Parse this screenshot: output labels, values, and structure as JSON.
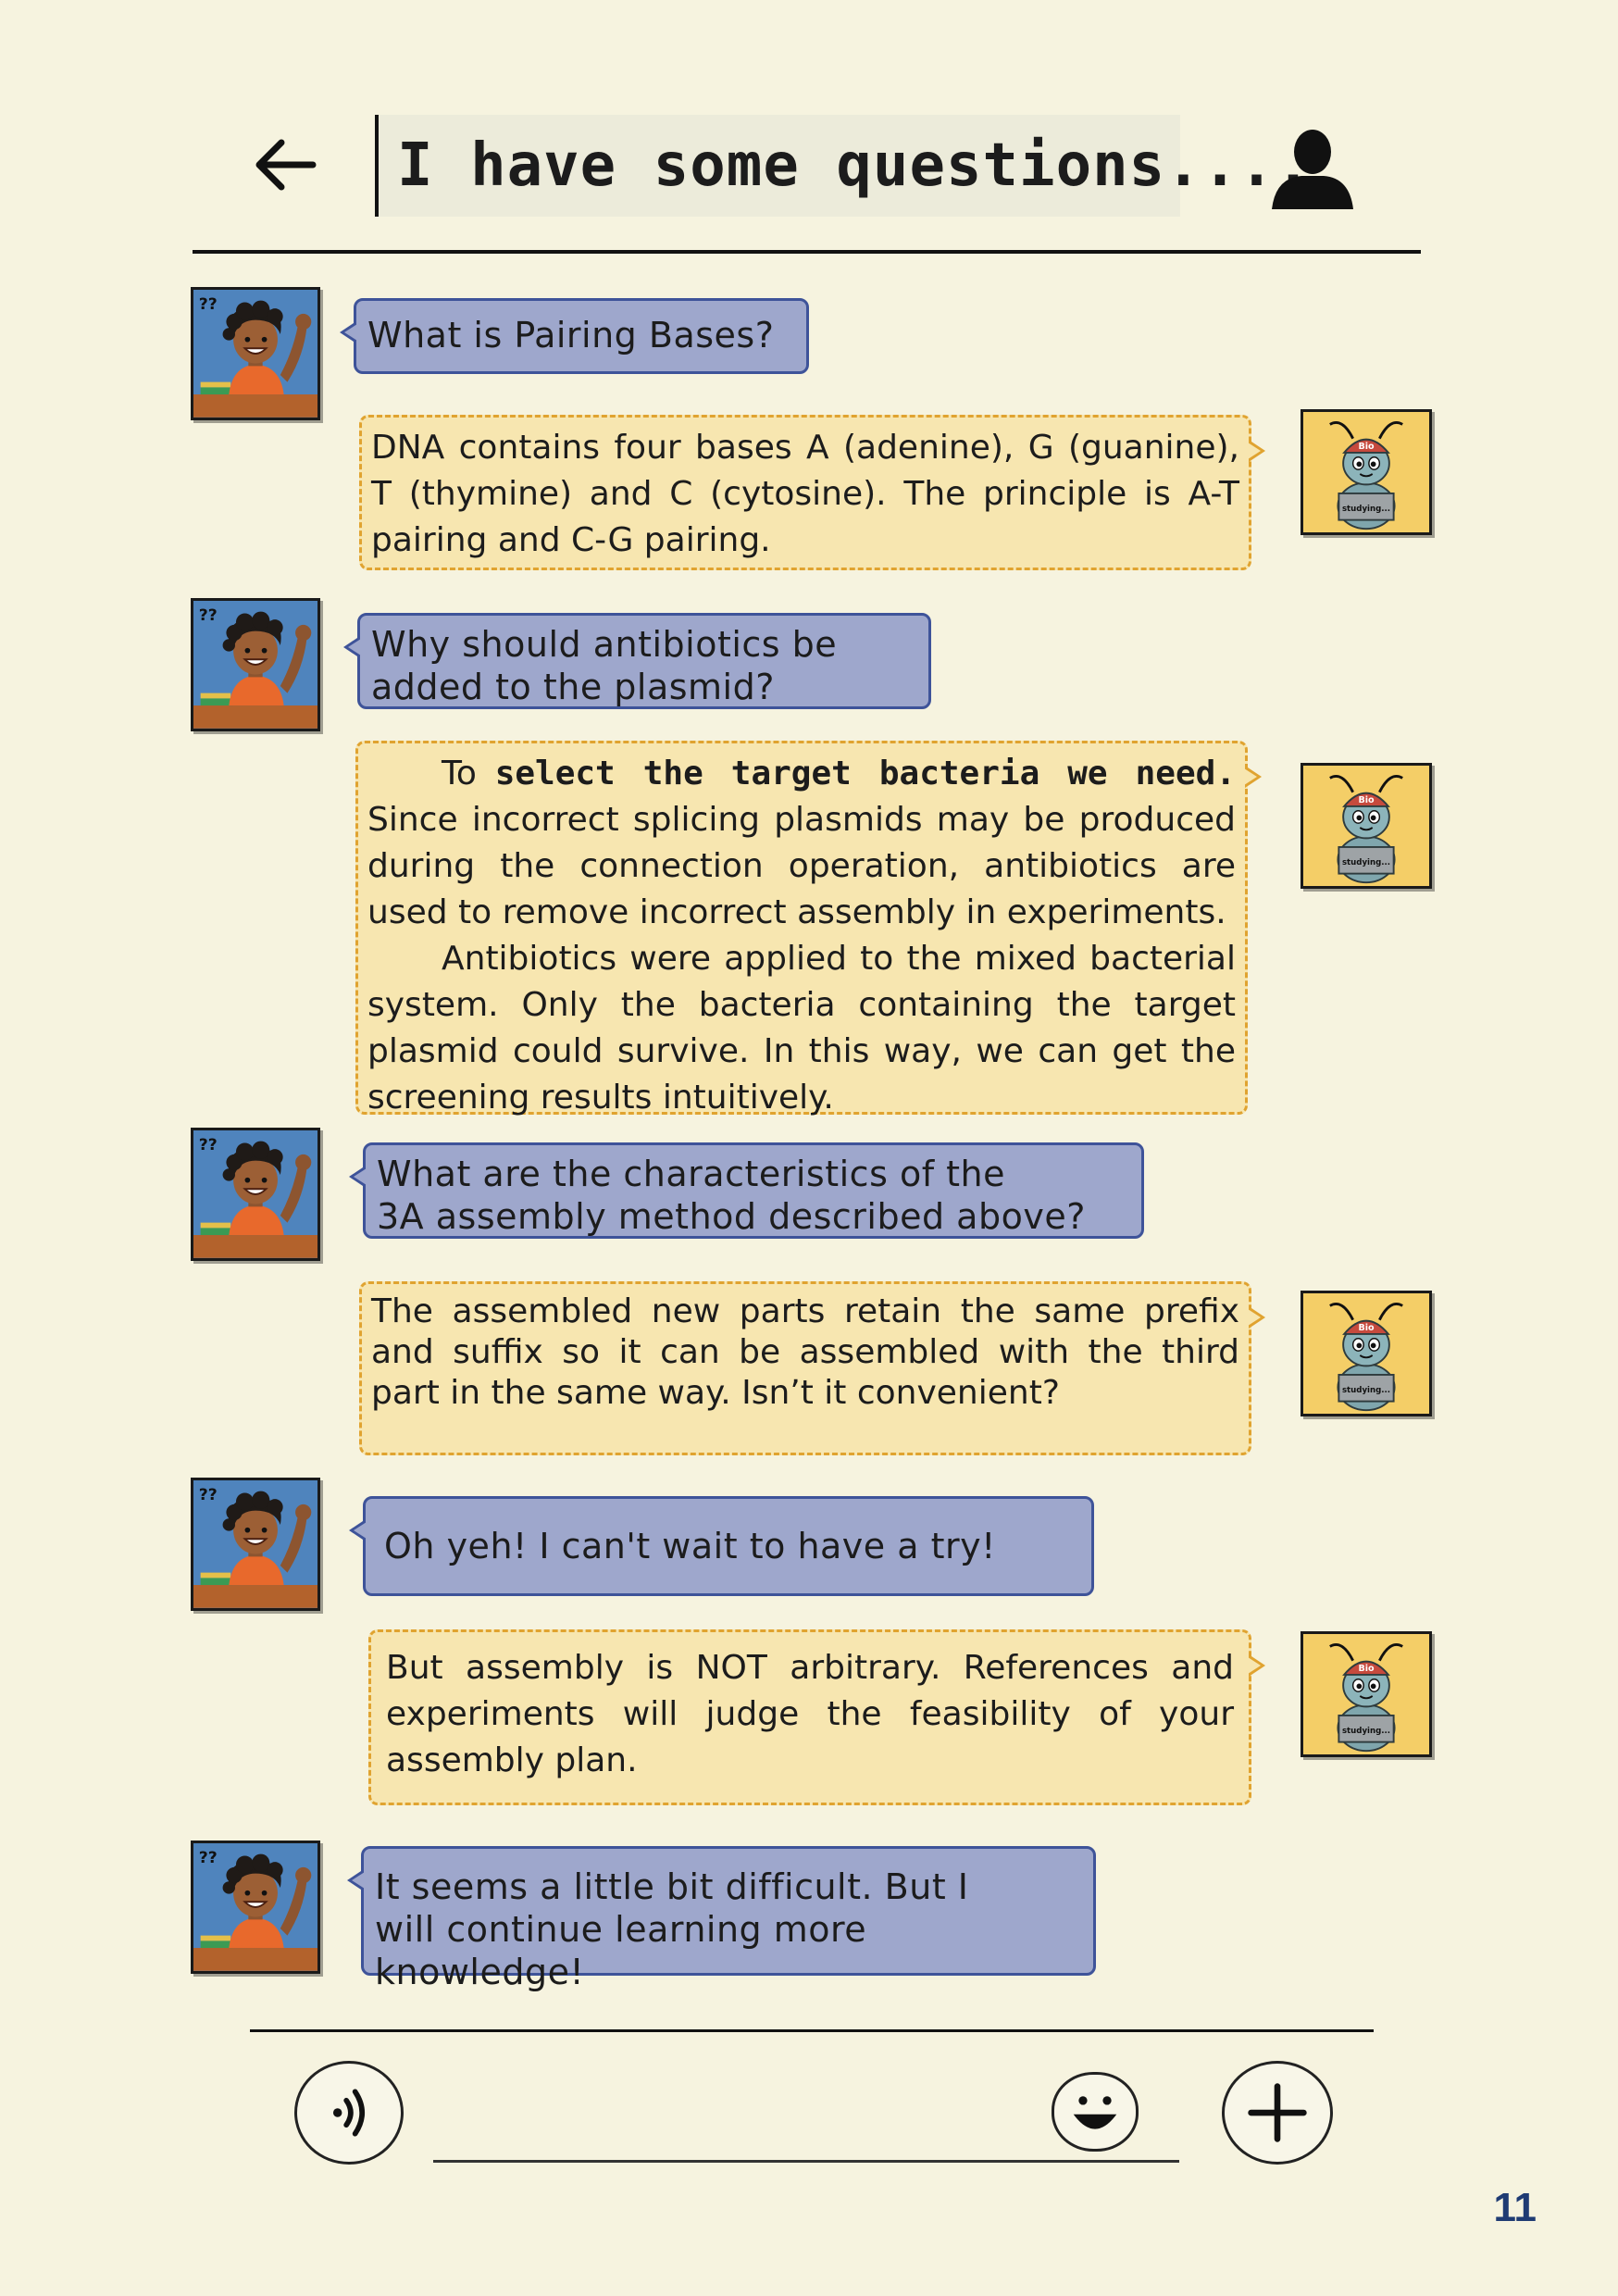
{
  "header": {
    "title": "I have some questions....",
    "back_icon": "back-arrow-icon",
    "profile_icon": "user-silhouette-icon"
  },
  "avatars": {
    "student": {
      "marks": "??",
      "color": "#4f84bd"
    },
    "bee": {
      "label": "Bio",
      "laptop_text": "studying..."
    }
  },
  "messages": [
    {
      "role": "student",
      "text": "What is Pairing Bases?"
    },
    {
      "role": "bee",
      "text": "DNA contains four bases A (adenine), G (guanine), T (thymine) and C (cytosine). The principle is A-T pairing and C-G pairing."
    },
    {
      "role": "student",
      "line1": "Why should antibiotics be",
      "line2": "added to the plasmid?"
    },
    {
      "role": "bee",
      "lead": "To ",
      "bold": "select the target bacteria we need.",
      "p1_rest": "Since incorrect splicing plasmids may be produced during the connection operation, antibiotics are used to remove incorrect assembly in experiments.",
      "p2": "Antibiotics were applied to the mixed bacterial system. Only the bacteria containing the target plasmid could survive. In this way, we can get the screening results intuitively."
    },
    {
      "role": "student",
      "line1": "What are the characteristics of the",
      "line2": "3A assembly method described above?"
    },
    {
      "role": "bee",
      "text": "The assembled new parts retain the same prefix and suffix so it can be assembled with the third part in the same way. Isn’t it convenient?"
    },
    {
      "role": "student",
      "text": "Oh yeh! I can't wait to have a try!"
    },
    {
      "role": "bee",
      "text": "But assembly is NOT arbitrary. References and experiments will judge the feasibility of your assembly plan."
    },
    {
      "role": "student",
      "line1": "It seems a little bit difficult. But I",
      "line2": "will continue learning more knowledge!"
    }
  ],
  "footer": {
    "voice_icon": "voice-icon",
    "emoji_icon": "smiley-icon",
    "plus_icon": "plus-icon",
    "page_number": "11"
  },
  "colors": {
    "page_background": "#f6f3df",
    "question_bubble": "#9ea7cc",
    "question_border": "#3e5399",
    "answer_bubble": "#f7e6b0",
    "answer_border": "#e0a330",
    "page_number": "#1f3b73"
  }
}
